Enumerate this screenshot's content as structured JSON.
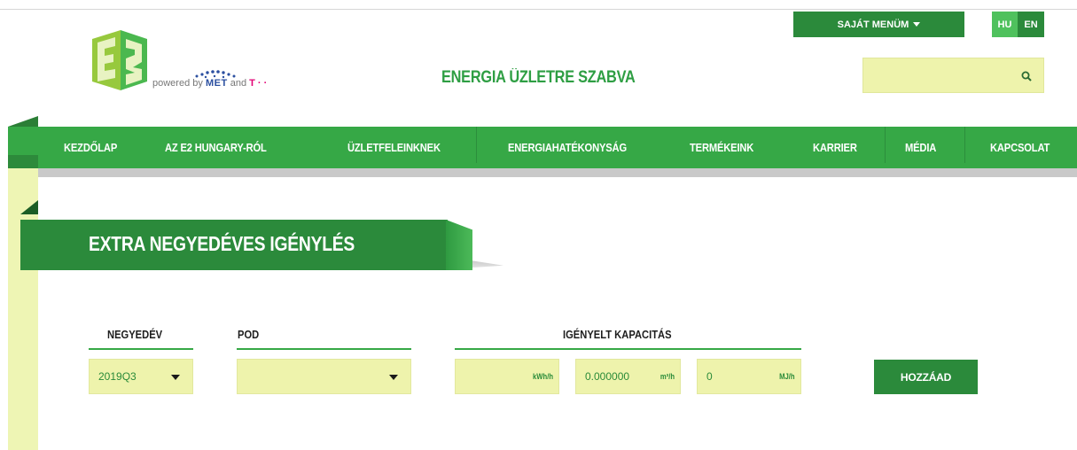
{
  "header": {
    "powered_prefix": "powered by",
    "powered_met": "MET",
    "powered_and": "and",
    "powered_tel": "T · ·",
    "brand_title": "ENERGIA ÜZLETRE SZABVA",
    "my_menu_label": "SAJÁT MENÜM",
    "languages": [
      "HU",
      "EN"
    ],
    "active_language": "HU",
    "search": {
      "value": "",
      "placeholder": ""
    }
  },
  "nav": {
    "items": [
      {
        "label": "KEZDŐLAP"
      },
      {
        "label": "AZ E2 HUNGARY-RÓL"
      },
      {
        "label": "ÜZLETFELEINKNEK"
      },
      {
        "label": "ENERGIAHATÉKONYSÁG"
      },
      {
        "label": "TERMÉKEINK"
      },
      {
        "label": "KARRIER"
      },
      {
        "label": "MÉDIA"
      },
      {
        "label": "KAPCSOLAT"
      }
    ]
  },
  "page": {
    "title": "EXTRA NEGYEDÉVES IGÉNYLÉS"
  },
  "form": {
    "columns": {
      "quarter": "NEGYEDÉV",
      "pod": "POD",
      "capacity": "IGÉNYELT KAPACITÁS"
    },
    "quarter_value": "2019Q3",
    "pod_value": "",
    "capacity_kwh": {
      "value": "",
      "unit": "kWh/h"
    },
    "capacity_m3": {
      "value": "0.000000",
      "unit": "m³/h"
    },
    "capacity_mj": {
      "value": "0",
      "unit": "MJ/h"
    },
    "add_button": "HOZZÁAD"
  },
  "colors": {
    "primary_green": "#36a846",
    "dark_green": "#2b8a3b",
    "field_yellow": "#eef3ac",
    "brand_green": "#2e9e43"
  },
  "icons": [
    "e2-logo",
    "met-dots-icon",
    "caret-down-icon",
    "search-icon"
  ]
}
